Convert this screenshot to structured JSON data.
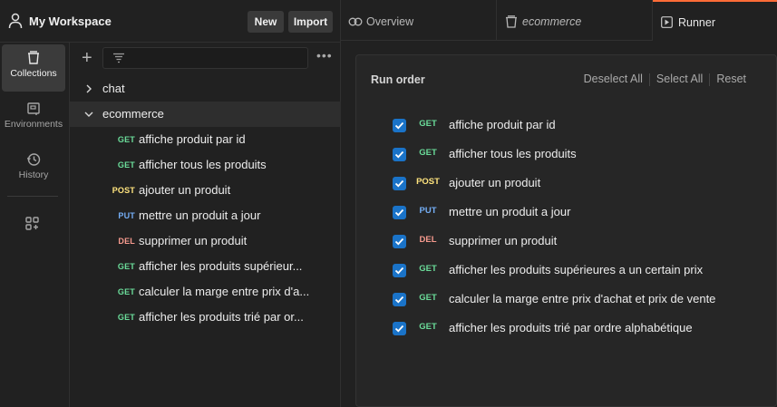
{
  "workspace": {
    "title": "My Workspace",
    "new_label": "New",
    "import_label": "Import"
  },
  "rail": {
    "items": [
      {
        "label": "Collections",
        "icon": "collections-icon",
        "active": true
      },
      {
        "label": "Environments",
        "icon": "environments-icon",
        "active": false
      },
      {
        "label": "History",
        "icon": "history-icon",
        "active": false
      }
    ],
    "extra_icon": "apps-add-icon"
  },
  "sidebar": {
    "collections": [
      {
        "name": "chat",
        "expanded": false
      },
      {
        "name": "ecommerce",
        "expanded": true
      }
    ],
    "requests": [
      {
        "method": "GET",
        "name": "affiche produit par id"
      },
      {
        "method": "GET",
        "name": "afficher tous les produits"
      },
      {
        "method": "POST",
        "name": "ajouter un produit"
      },
      {
        "method": "PUT",
        "name": "mettre un produit a jour"
      },
      {
        "method": "DEL",
        "name": "supprimer un produit"
      },
      {
        "method": "GET",
        "name": "afficher les produits supérieur..."
      },
      {
        "method": "GET",
        "name": "calculer la marge entre prix d'a..."
      },
      {
        "method": "GET",
        "name": "afficher les produits trié par or..."
      }
    ]
  },
  "tabs": [
    {
      "label": "Overview",
      "icon": "overview-icon"
    },
    {
      "label": "ecommerce",
      "icon": "collection-icon"
    },
    {
      "label": "Runner",
      "icon": "runner-icon",
      "active": true
    }
  ],
  "runner": {
    "heading": "Run order",
    "deselect_all": "Deselect All",
    "select_all": "Select All",
    "reset": "Reset",
    "items": [
      {
        "method": "GET",
        "name": "affiche produit par id",
        "checked": true
      },
      {
        "method": "GET",
        "name": "afficher tous les produits",
        "checked": true
      },
      {
        "method": "POST",
        "name": "ajouter un produit",
        "checked": true
      },
      {
        "method": "PUT",
        "name": "mettre un produit a jour",
        "checked": true
      },
      {
        "method": "DEL",
        "name": "supprimer un produit",
        "checked": true
      },
      {
        "method": "GET",
        "name": "afficher les produits supérieures a un certain prix",
        "checked": true
      },
      {
        "method": "GET",
        "name": "calculer la marge entre prix d'achat et prix de vente",
        "checked": true
      },
      {
        "method": "GET",
        "name": "afficher les produits trié par ordre alphabétique",
        "checked": true
      }
    ]
  },
  "colors": {
    "accent": "#ff6c37",
    "get": "#6bdd9a",
    "post": "#ffe47e",
    "put": "#74aef6",
    "del": "#f79a8e",
    "checkbox": "#1a73c8"
  }
}
